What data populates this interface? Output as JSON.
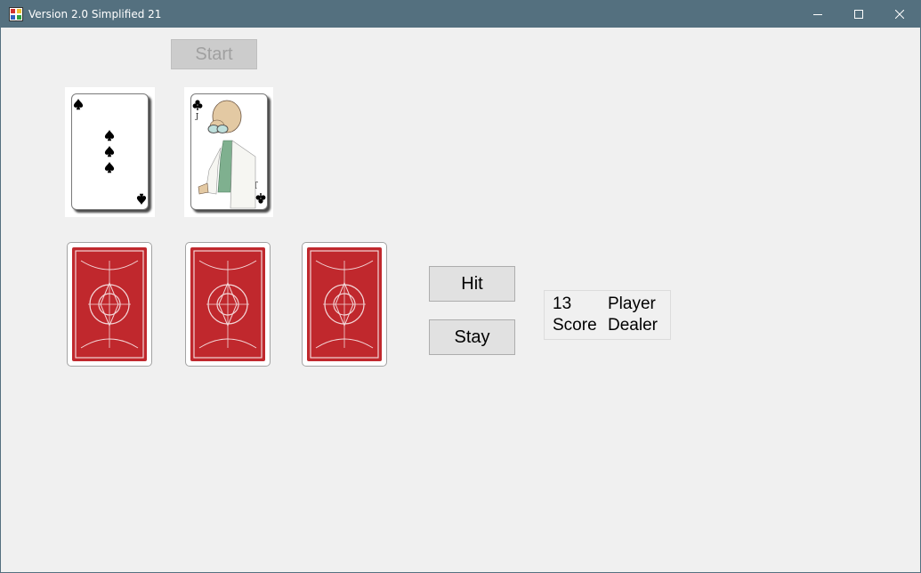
{
  "window": {
    "title": "Version 2.0 Simplified 21",
    "controls": {
      "minimize": "minimize",
      "maximize": "maximize",
      "close": "close"
    }
  },
  "buttons": {
    "start": "Start",
    "hit": "Hit",
    "stay": "Stay"
  },
  "dealer_cards": [
    {
      "rank": "3",
      "suit": "spades",
      "face_up": true
    },
    {
      "rank": "J",
      "suit": "clubs",
      "face_up": true
    }
  ],
  "player_cards": [
    {
      "face_up": false,
      "back_color": "#c0282d"
    },
    {
      "face_up": false,
      "back_color": "#c0282d"
    },
    {
      "face_up": false,
      "back_color": "#c0282d"
    }
  ],
  "score_panel": {
    "player_value": "13",
    "player_label": "Player",
    "dealer_value": "Score",
    "dealer_label": "Dealer"
  },
  "colors": {
    "titlebar": "#54707f",
    "background": "#f0f0f0",
    "card_back": "#c0282d"
  }
}
